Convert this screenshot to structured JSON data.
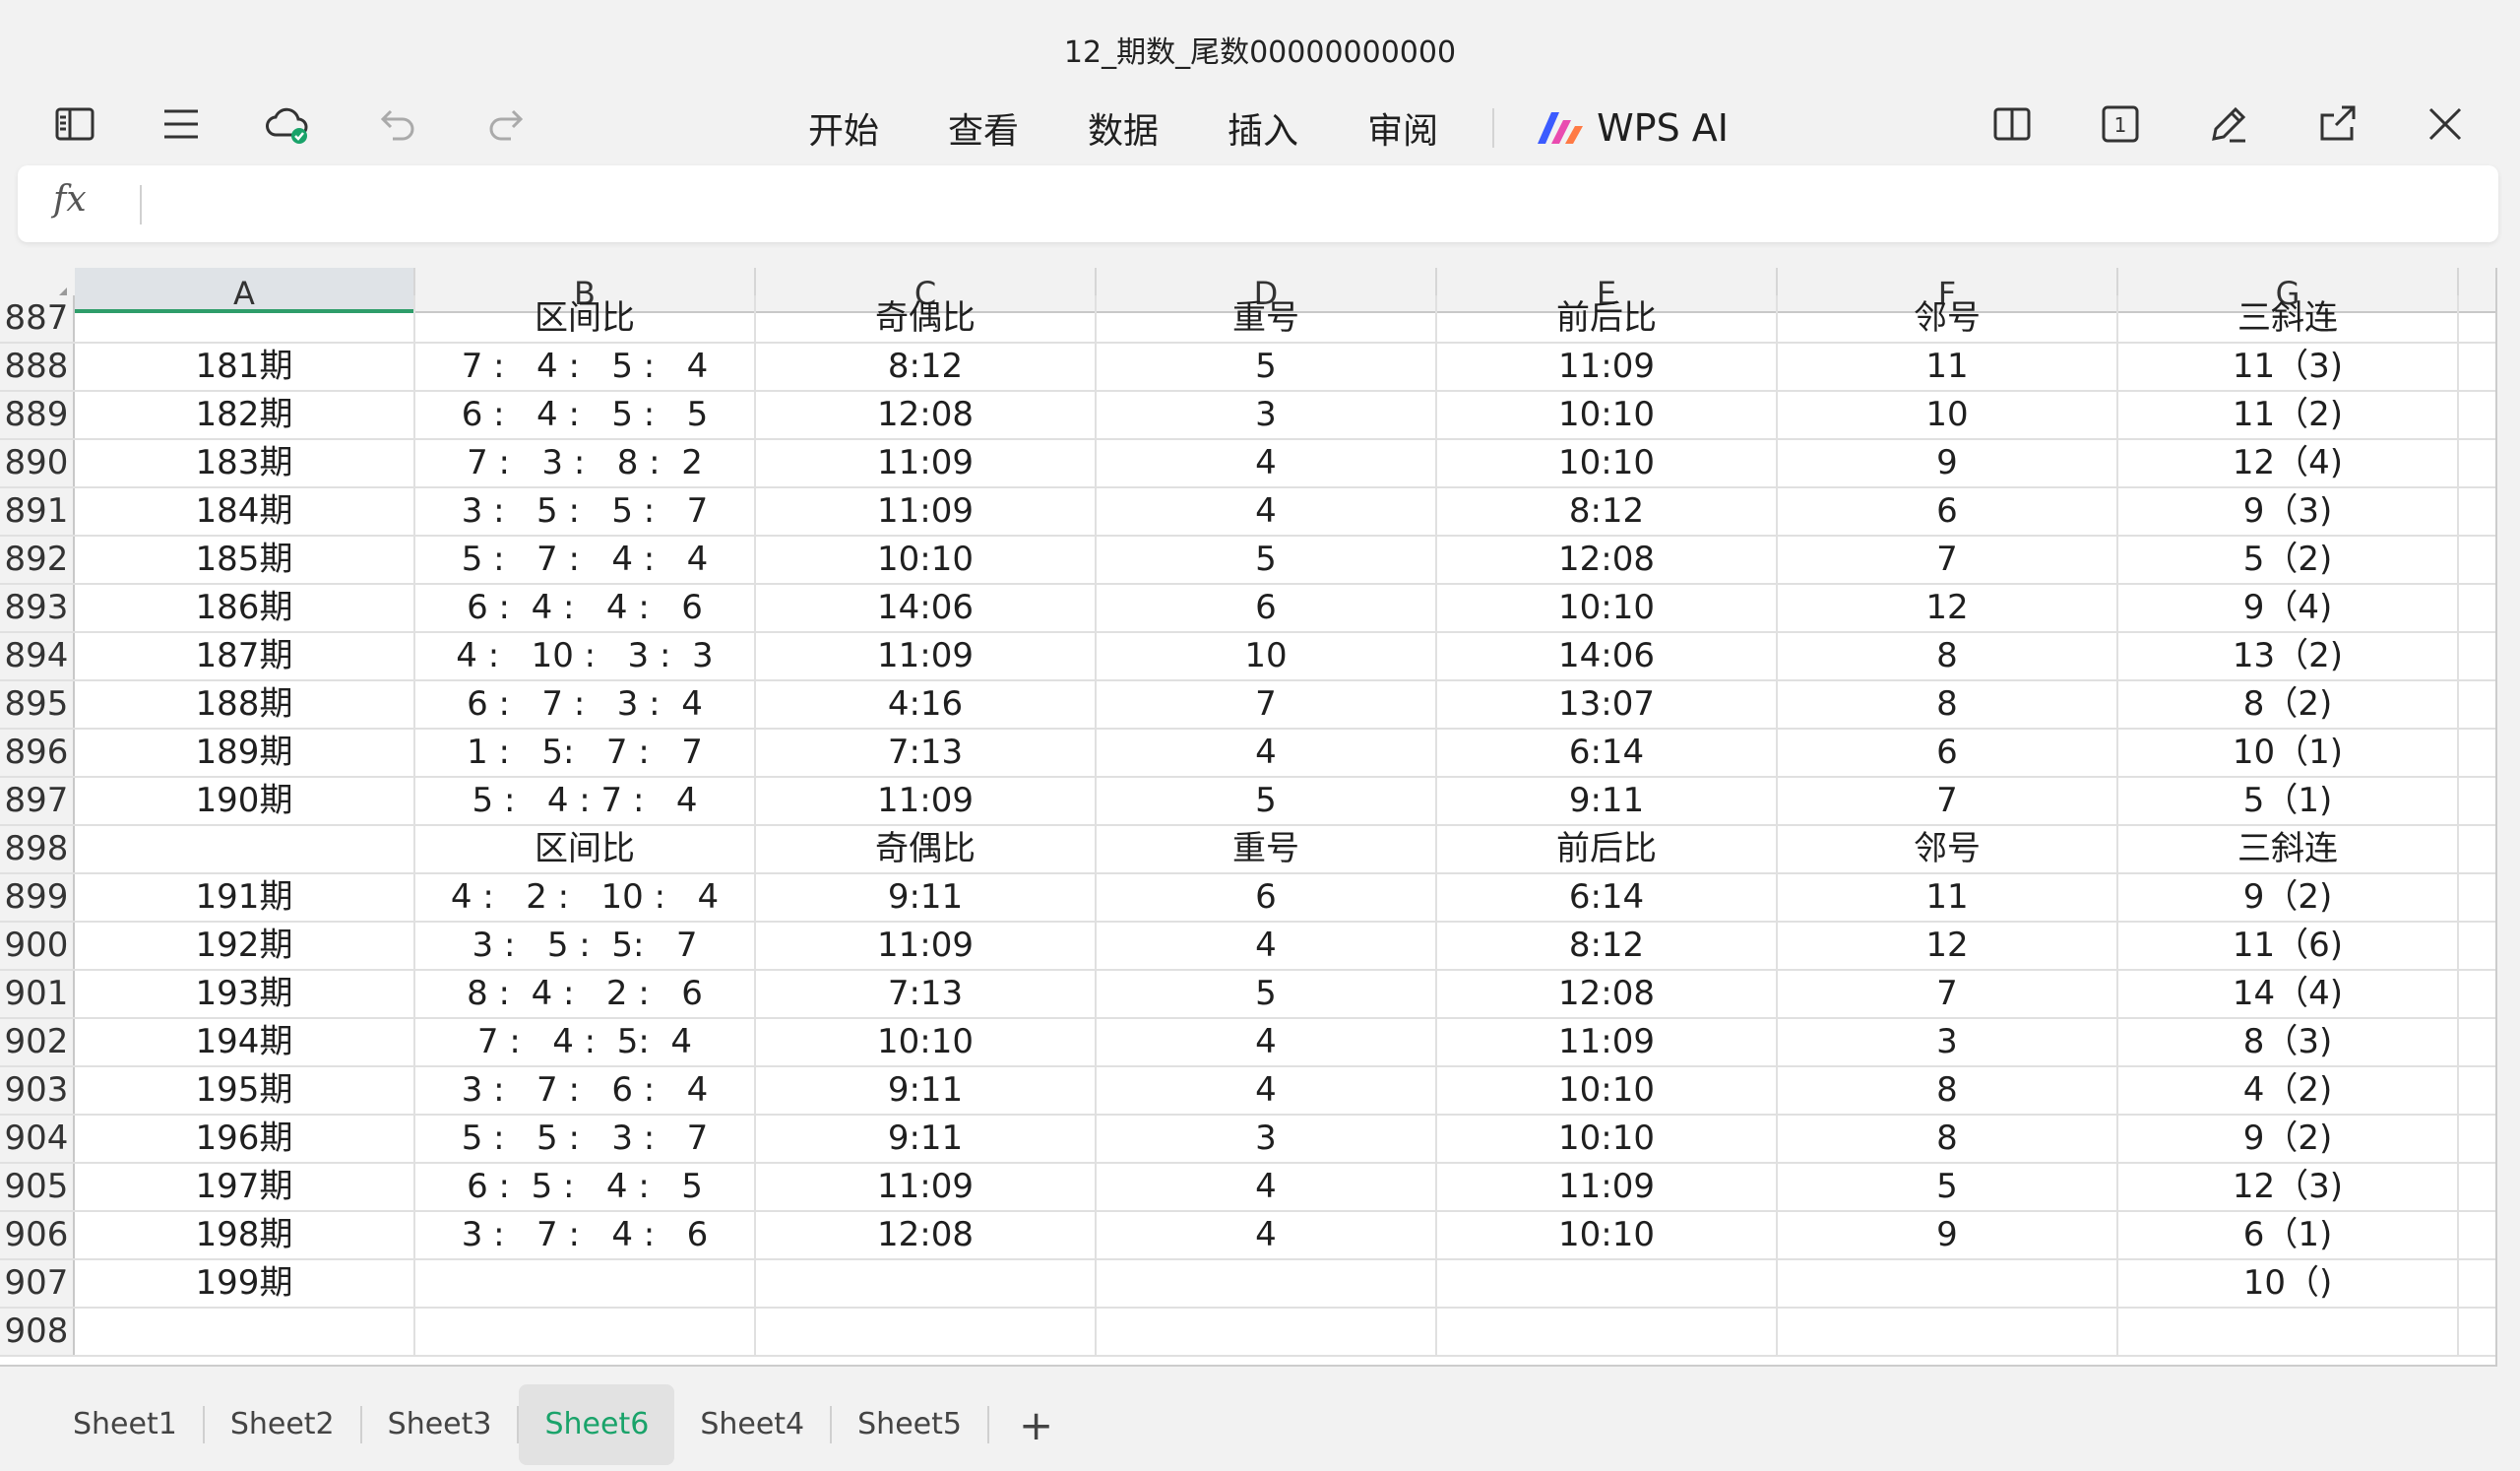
{
  "window": {
    "title": "12_期数_尾数00000000000"
  },
  "toolbar": {
    "left_icons": [
      "sidebar-toggle-icon",
      "menu-icon",
      "cloud-sync-icon",
      "undo-icon",
      "redo-icon"
    ],
    "menu": [
      "开始",
      "查看",
      "数据",
      "插入",
      "审阅"
    ],
    "ai_label": "WPS AI",
    "right_icons": [
      "split-view-icon",
      "sheet-count-icon",
      "pen-icon",
      "share-icon",
      "close-icon"
    ],
    "sheet_count_badge": "1"
  },
  "formula_bar": {
    "fx_label": "fx",
    "value": ""
  },
  "grid": {
    "columns": [
      "A",
      "B",
      "C",
      "D",
      "E",
      "F",
      "G"
    ],
    "selected_column": "A",
    "rows": [
      {
        "num": "887",
        "cells": [
          "",
          "区间比",
          "奇偶比",
          "重号",
          "前后比",
          "邻号",
          "三斜连"
        ]
      },
      {
        "num": "888",
        "cells": [
          "181期",
          "7 :   4 :   5 :   4",
          "8:12",
          "5",
          "11:09",
          "11",
          "11（3)"
        ]
      },
      {
        "num": "889",
        "cells": [
          "182期",
          "6 :   4 :   5 :   5",
          "12:08",
          "3",
          "10:10",
          "10",
          "11（2)"
        ]
      },
      {
        "num": "890",
        "cells": [
          "183期",
          "7 :   3 :   8 :  2",
          "11:09",
          "4",
          "10:10",
          "9",
          "12（4)"
        ]
      },
      {
        "num": "891",
        "cells": [
          "184期",
          "3 :   5 :   5 :   7",
          "11:09",
          "4",
          "8:12",
          "6",
          "9（3)"
        ]
      },
      {
        "num": "892",
        "cells": [
          "185期",
          "5 :   7 :   4 :   4",
          "10:10",
          "5",
          "12:08",
          "7",
          "5（2)"
        ]
      },
      {
        "num": "893",
        "cells": [
          "186期",
          "6 :  4 :   4 :   6",
          "14:06",
          "6",
          "10:10",
          "12",
          "9（4)"
        ]
      },
      {
        "num": "894",
        "cells": [
          "187期",
          "4 :   10 :   3 :  3",
          "11:09",
          "10",
          "14:06",
          "8",
          "13（2)"
        ]
      },
      {
        "num": "895",
        "cells": [
          "188期",
          "6 :   7 :   3 :  4",
          "4:16",
          "7",
          "13:07",
          "8",
          "8（2)"
        ]
      },
      {
        "num": "896",
        "cells": [
          "189期",
          "1 :   5:   7 :   7",
          "7:13",
          "4",
          "6:14",
          "6",
          "10（1)"
        ]
      },
      {
        "num": "897",
        "cells": [
          "190期",
          "5 :   4 : 7 :   4",
          "11:09",
          "5",
          "9:11",
          "7",
          "5（1)"
        ]
      },
      {
        "num": "898",
        "cells": [
          "",
          "区间比",
          "奇偶比",
          "重号",
          "前后比",
          "邻号",
          "三斜连"
        ]
      },
      {
        "num": "899",
        "cells": [
          "191期",
          "4 :   2 :   10 :   4",
          "9:11",
          "6",
          "6:14",
          "11",
          "9（2)"
        ]
      },
      {
        "num": "900",
        "cells": [
          "192期",
          "3 :   5 :  5:   7",
          "11:09",
          "4",
          "8:12",
          "12",
          "11（6)"
        ]
      },
      {
        "num": "901",
        "cells": [
          "193期",
          "8 :  4 :   2 :   6",
          "7:13",
          "5",
          "12:08",
          "7",
          "14（4)"
        ]
      },
      {
        "num": "902",
        "cells": [
          "194期",
          "7 :   4 :  5:  4",
          "10:10",
          "4",
          "11:09",
          "3",
          "8（3)"
        ]
      },
      {
        "num": "903",
        "cells": [
          "195期",
          "3 :   7 :   6 :   4",
          "9:11",
          "4",
          "10:10",
          "8",
          "4（2)"
        ]
      },
      {
        "num": "904",
        "cells": [
          "196期",
          "5 :   5 :   3 :   7",
          "9:11",
          "3",
          "10:10",
          "8",
          "9（2)"
        ]
      },
      {
        "num": "905",
        "cells": [
          "197期",
          "6 :  5 :   4 :   5",
          "11:09",
          "4",
          "11:09",
          "5",
          "12（3)"
        ]
      },
      {
        "num": "906",
        "cells": [
          "198期",
          "3 :   7 :   4 :   6",
          "12:08",
          "4",
          "10:10",
          "9",
          "6（1)"
        ]
      },
      {
        "num": "907",
        "cells": [
          "199期",
          "",
          "",
          "",
          "",
          "",
          "10（)"
        ]
      },
      {
        "num": "908",
        "cells": [
          "",
          "",
          "",
          "",
          "",
          "",
          ""
        ]
      }
    ]
  },
  "sheet_tabs": {
    "tabs": [
      "Sheet1",
      "Sheet2",
      "Sheet3",
      "Sheet6",
      "Sheet4",
      "Sheet5"
    ],
    "active": "Sheet6",
    "add_label": "+"
  },
  "colors": {
    "accent": "#1aa36a",
    "selection": "#2e9d6a",
    "background": "#f2f2f2"
  }
}
